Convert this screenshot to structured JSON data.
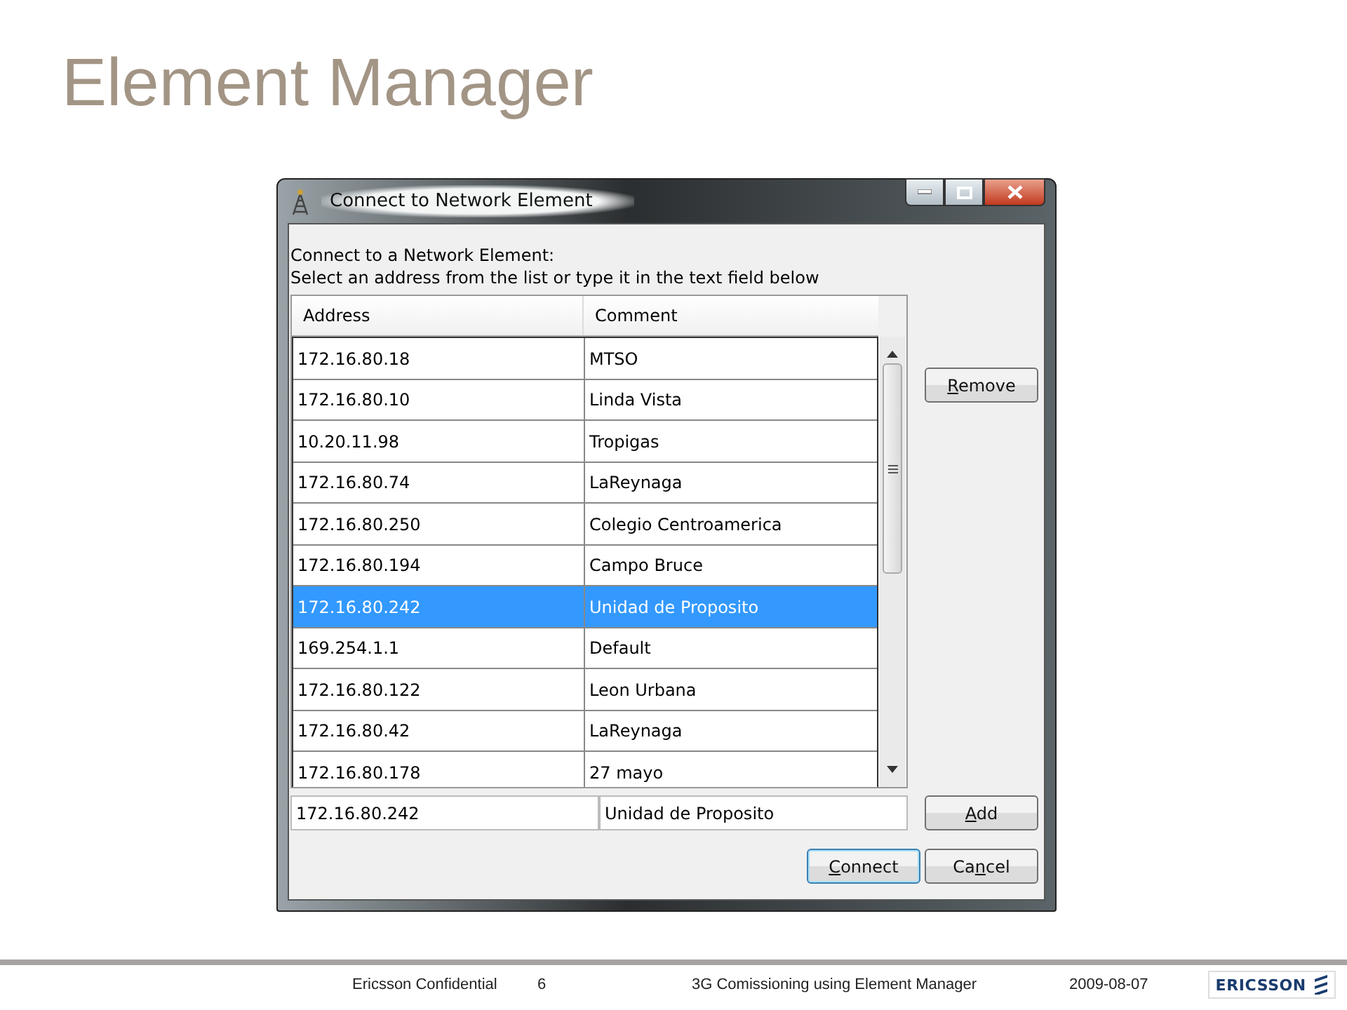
{
  "slide_title": "Element Manager",
  "dialog": {
    "title": "Connect to Network Element",
    "instructions": [
      "Connect to a Network Element:",
      "Select an address from the list or type it in the text field below"
    ],
    "table": {
      "columns": [
        "Address",
        "Comment"
      ],
      "rows": [
        {
          "address": "172.16.80.18",
          "comment": "MTSO",
          "selected": false
        },
        {
          "address": "172.16.80.10",
          "comment": "Linda Vista",
          "selected": false
        },
        {
          "address": "10.20.11.98",
          "comment": "Tropigas",
          "selected": false
        },
        {
          "address": "172.16.80.74",
          "comment": "LaReynaga",
          "selected": false
        },
        {
          "address": "172.16.80.250",
          "comment": "Colegio Centroamerica",
          "selected": false
        },
        {
          "address": "172.16.80.194",
          "comment": "Campo Bruce",
          "selected": false
        },
        {
          "address": "172.16.80.242",
          "comment": "Unidad de Proposito",
          "selected": true
        },
        {
          "address": "169.254.1.1",
          "comment": "Default",
          "selected": false
        },
        {
          "address": "172.16.80.122",
          "comment": "Leon Urbana",
          "selected": false
        },
        {
          "address": "172.16.80.42",
          "comment": "LaReynaga",
          "selected": false
        },
        {
          "address": "172.16.80.178",
          "comment": "27 mayo",
          "selected": false
        }
      ]
    },
    "address_field": {
      "value": "172.16.80.242"
    },
    "comment_field": {
      "value": "Unidad de Proposito"
    },
    "buttons": [
      {
        "label_parts": [
          {
            "text": "R",
            "underlined": true
          },
          {
            "text": "emove",
            "underlined": false
          }
        ],
        "kind": "side",
        "default": false
      },
      {
        "label_parts": [
          {
            "text": "A",
            "underlined": true
          },
          {
            "text": "dd",
            "underlined": false
          }
        ],
        "kind": "add",
        "default": false
      },
      {
        "label_parts": [
          {
            "text": "C",
            "underlined": true
          },
          {
            "text": "onnect",
            "underlined": false
          }
        ],
        "kind": "bottom",
        "default": true
      },
      {
        "label_parts": [
          {
            "text": "Ca",
            "underlined": false
          },
          {
            "text": "n",
            "underlined": true
          },
          {
            "text": "cel",
            "underlined": false
          }
        ],
        "kind": "bottom",
        "default": false
      }
    ]
  },
  "footer": {
    "confidential": "Ericsson Confidential",
    "page": "6",
    "topic": "3G Comissioning using Element Manager",
    "date": "2009-08-07",
    "logo_text": "ERICSSON"
  }
}
